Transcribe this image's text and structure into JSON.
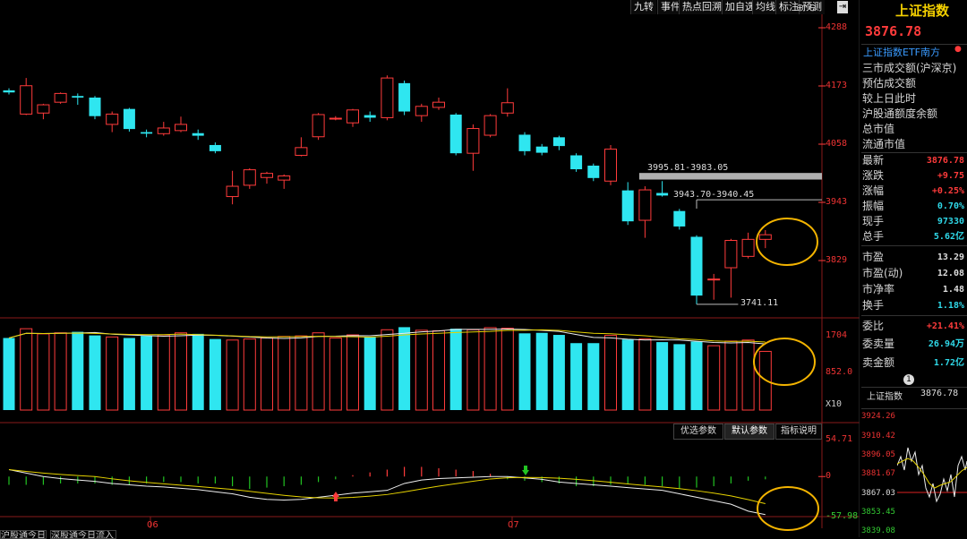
{
  "toolbar": {
    "buttons": [
      "九转",
      "事件",
      "热点回溯",
      "加自选",
      "均线",
      "标注",
      "预测"
    ],
    "close_icon": "exit-icon"
  },
  "price_axis": {
    "ticks": [
      "4288",
      "4173",
      "4058",
      "3943",
      "3829"
    ]
  },
  "annotations": {
    "resistance1": "3995.81-3983.05",
    "resistance2": "3943.70-3940.45",
    "low": "3741.11"
  },
  "volume_axis": {
    "ticks": [
      "1704",
      "852.0",
      "X10"
    ]
  },
  "macd_params": {
    "optimize": "优选参数",
    "default": "默认参数",
    "help": "指标说明"
  },
  "macd_axis": {
    "ticks": [
      "54.71",
      "0",
      "-57.98"
    ]
  },
  "date_axis": {
    "labels": [
      "06",
      "07"
    ]
  },
  "bottom_tabs": [
    "沪股通今日流入",
    "深股通今日流入"
  ],
  "right_panel": {
    "title": "上证指数",
    "price": "3876.78",
    "etf": "上证指数ETF南方",
    "info_rows": [
      "三市成交额(沪深京)",
      "预估成交额",
      "较上日此时",
      "沪股通额度余额",
      "总市值",
      "流通市值"
    ],
    "quote_rows": [
      {
        "label": "最新",
        "value": "3876.78",
        "color": "red"
      },
      {
        "label": "涨跌",
        "value": "+9.75",
        "color": "red"
      },
      {
        "label": "涨幅",
        "value": "+0.25%",
        "color": "red"
      },
      {
        "label": "振幅",
        "value": "0.70%",
        "color": "cyan"
      },
      {
        "label": "现手",
        "value": "97330",
        "color": "cyan"
      },
      {
        "label": "总手",
        "value": "5.62亿",
        "color": "cyan"
      }
    ],
    "ratio_rows": [
      {
        "label": "市盈",
        "value": "13.29"
      },
      {
        "label": "市盈(动)",
        "value": "12.08"
      },
      {
        "label": "市净率",
        "value": "1.48"
      },
      {
        "label": "换手",
        "value": "1.18%"
      }
    ],
    "order_rows": [
      {
        "label": "委比",
        "value": "+21.41%",
        "color": "red"
      },
      {
        "label": "委卖量",
        "value": "26.94万",
        "color": "cyan"
      },
      {
        "label": "卖金额",
        "value": "1.72亿",
        "color": "cyan"
      }
    ],
    "badge": "1",
    "mini_title": "上证指数",
    "mini_price": "3876.78",
    "mini_ticks": [
      "3924.26",
      "3910.42",
      "3896.05",
      "3881.67",
      "3867.03",
      "3853.45",
      "3839.08"
    ]
  },
  "chart_data": {
    "type": "candlestick",
    "candles": [
      {
        "o": 4156,
        "c": 4152,
        "h": 4160,
        "l": 4148
      },
      {
        "o": 4110,
        "c": 4165,
        "h": 4180,
        "l": 4108
      },
      {
        "o": 4112,
        "c": 4128,
        "h": 4130,
        "l": 4100
      },
      {
        "o": 4133,
        "c": 4150,
        "h": 4152,
        "l": 4130
      },
      {
        "o": 4145,
        "c": 4142,
        "h": 4150,
        "l": 4128
      },
      {
        "o": 4142,
        "c": 4106,
        "h": 4145,
        "l": 4100
      },
      {
        "o": 4090,
        "c": 4110,
        "h": 4115,
        "l": 4075
      },
      {
        "o": 4120,
        "c": 4081,
        "h": 4122,
        "l": 4076
      },
      {
        "o": 4075,
        "c": 4072,
        "h": 4080,
        "l": 4065
      },
      {
        "o": 4072,
        "c": 4083,
        "h": 4095,
        "l": 4068
      },
      {
        "o": 4078,
        "c": 4090,
        "h": 4105,
        "l": 4075
      },
      {
        "o": 4073,
        "c": 4068,
        "h": 4080,
        "l": 4060
      },
      {
        "o": 4050,
        "c": 4038,
        "h": 4055,
        "l": 4034
      },
      {
        "o": 3950,
        "c": 3970,
        "h": 4000,
        "l": 3935
      },
      {
        "o": 3972,
        "c": 4002,
        "h": 4005,
        "l": 3965
      },
      {
        "o": 3987,
        "c": 3995,
        "h": 3998,
        "l": 3975
      },
      {
        "o": 3982,
        "c": 3990,
        "h": 3993,
        "l": 3965
      },
      {
        "o": 4030,
        "c": 4045,
        "h": 4065,
        "l": 4028
      },
      {
        "o": 4066,
        "c": 4109,
        "h": 4112,
        "l": 4060
      },
      {
        "o": 4102,
        "c": 4102,
        "h": 4106,
        "l": 4098
      },
      {
        "o": 4093,
        "c": 4118,
        "h": 4120,
        "l": 4085
      },
      {
        "o": 4108,
        "c": 4103,
        "h": 4115,
        "l": 4095
      },
      {
        "o": 4103,
        "c": 4180,
        "h": 4185,
        "l": 4098
      },
      {
        "o": 4170,
        "c": 4115,
        "h": 4175,
        "l": 4108
      },
      {
        "o": 4107,
        "c": 4125,
        "h": 4130,
        "l": 4095
      },
      {
        "o": 4123,
        "c": 4133,
        "h": 4142,
        "l": 4118
      },
      {
        "o": 4109,
        "c": 4034,
        "h": 4112,
        "l": 4030
      },
      {
        "o": 4034,
        "c": 4082,
        "h": 4090,
        "l": 4000
      },
      {
        "o": 4069,
        "c": 4107,
        "h": 4110,
        "l": 4065
      },
      {
        "o": 4112,
        "c": 4132,
        "h": 4160,
        "l": 4105
      },
      {
        "o": 4070,
        "c": 4038,
        "h": 4075,
        "l": 4030
      },
      {
        "o": 4047,
        "c": 4035,
        "h": 4052,
        "l": 4030
      },
      {
        "o": 4065,
        "c": 4048,
        "h": 4068,
        "l": 4040
      },
      {
        "o": 4030,
        "c": 4003,
        "h": 4034,
        "l": 3998
      },
      {
        "o": 4010,
        "c": 3986,
        "h": 4014,
        "l": 3980
      },
      {
        "o": 3980,
        "c": 4042,
        "h": 4050,
        "l": 3972
      },
      {
        "o": 3962,
        "c": 3902,
        "h": 3978,
        "l": 3895
      },
      {
        "o": 3904,
        "c": 3963,
        "h": 3970,
        "l": 3870
      },
      {
        "o": 3957,
        "c": 3952,
        "h": 3980,
        "l": 3950
      },
      {
        "o": 3922,
        "c": 3892,
        "h": 3926,
        "l": 3886
      },
      {
        "o": 3872,
        "c": 3758,
        "h": 3875,
        "l": 3741
      },
      {
        "o": 3790,
        "c": 3790,
        "h": 3800,
        "l": 3750
      },
      {
        "o": 3812,
        "c": 3865,
        "h": 3868,
        "l": 3754
      },
      {
        "o": 3834,
        "c": 3867,
        "h": 3880,
        "l": 3830
      },
      {
        "o": 3867,
        "c": 3876,
        "h": 3885,
        "l": 3850
      }
    ],
    "volumes": [
      1400,
      1580,
      1480,
      1500,
      1520,
      1450,
      1420,
      1400,
      1440,
      1460,
      1500,
      1480,
      1380,
      1360,
      1380,
      1400,
      1430,
      1440,
      1500,
      1400,
      1460,
      1420,
      1560,
      1610,
      1550,
      1540,
      1580,
      1560,
      1600,
      1590,
      1490,
      1500,
      1460,
      1300,
      1300,
      1450,
      1370,
      1380,
      1320,
      1280,
      1330,
      1250,
      1340,
      1360,
      1140
    ],
    "macd_diff": [
      10,
      5,
      0,
      -3,
      -5,
      -7,
      -10,
      -12,
      -14,
      -15,
      -17,
      -19,
      -22,
      -25,
      -30,
      -33,
      -34,
      -33,
      -30,
      -27,
      -24,
      -22,
      -20,
      -10,
      -5,
      -3,
      -2,
      -1,
      0,
      0,
      -2,
      -4,
      -8,
      -10,
      -12,
      -14,
      -16,
      -18,
      -20,
      -25,
      -30,
      -35,
      -40,
      -50,
      -55
    ],
    "macd_bars": [
      -12,
      -12,
      -12,
      -10,
      -10,
      -10,
      -12,
      -12,
      -10,
      -8,
      -8,
      -10,
      -10,
      -14,
      -18,
      -16,
      -14,
      -12,
      -8,
      -4,
      2,
      6,
      10,
      14,
      14,
      12,
      10,
      8,
      4,
      -4,
      -6,
      -8,
      -10,
      -14,
      -14,
      -12,
      -10,
      -12,
      -14,
      -18,
      -16,
      -14,
      -10,
      -6,
      -4
    ],
    "price_range": [
      3720,
      4300
    ],
    "macd_range": [
      -57.98,
      54.71
    ]
  }
}
